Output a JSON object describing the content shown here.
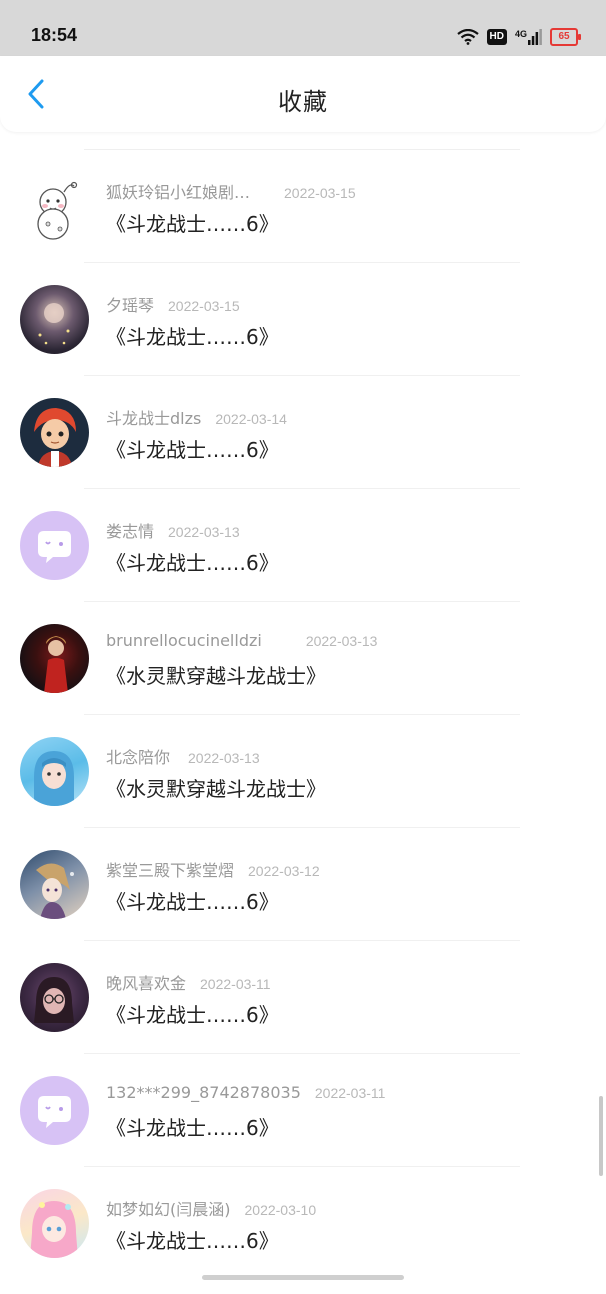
{
  "status_bar": {
    "time": "18:54",
    "network": "4G",
    "hd": "HD",
    "battery": "65",
    "icons": [
      "wifi-icon",
      "hd-icon",
      "signal-4g-icon",
      "battery-icon"
    ]
  },
  "header": {
    "title": "收藏",
    "back_icon": "chevron-left-icon",
    "accent": "#1e9bf0"
  },
  "items": [
    {
      "user": "狐妖玲铝小红娘剧…",
      "date": "2022-03-15",
      "title": "《斗龙战士……6》",
      "avatar": "cartoon-snowman-avatar"
    },
    {
      "user": "夕瑶琴",
      "date": "2022-03-15",
      "title": "《斗龙战士……6》",
      "avatar": "photo-avatar"
    },
    {
      "user": "斗龙战士dlzs",
      "date": "2022-03-14",
      "title": "《斗龙战士……6》",
      "avatar": "cartoon-boy-avatar"
    },
    {
      "user": "娄志情",
      "date": "2022-03-13",
      "title": "《斗龙战士……6》",
      "avatar": "default-chat-avatar"
    },
    {
      "user": "brunrellocucinelldzi",
      "date": "2022-03-13",
      "title": "《水灵默穿越斗龙战士》",
      "avatar": "photo-avatar"
    },
    {
      "user": "北念陪你",
      "date": "2022-03-13",
      "title": "《水灵默穿越斗龙战士》",
      "avatar": "photo-avatar"
    },
    {
      "user": "紫堂三殿下紫堂熠",
      "date": "2022-03-12",
      "title": "《斗龙战士……6》",
      "avatar": "anime-avatar"
    },
    {
      "user": "晚风喜欢金",
      "date": "2022-03-11",
      "title": "《斗龙战士……6》",
      "avatar": "photo-avatar"
    },
    {
      "user": "132***299_8742878035",
      "date": "2022-03-11",
      "title": "《斗龙战士……6》",
      "avatar": "default-chat-avatar"
    },
    {
      "user": "如梦如幻(闫晨涵)",
      "date": "2022-03-10",
      "title": "《斗龙战士……6》",
      "avatar": "anime-avatar"
    }
  ]
}
